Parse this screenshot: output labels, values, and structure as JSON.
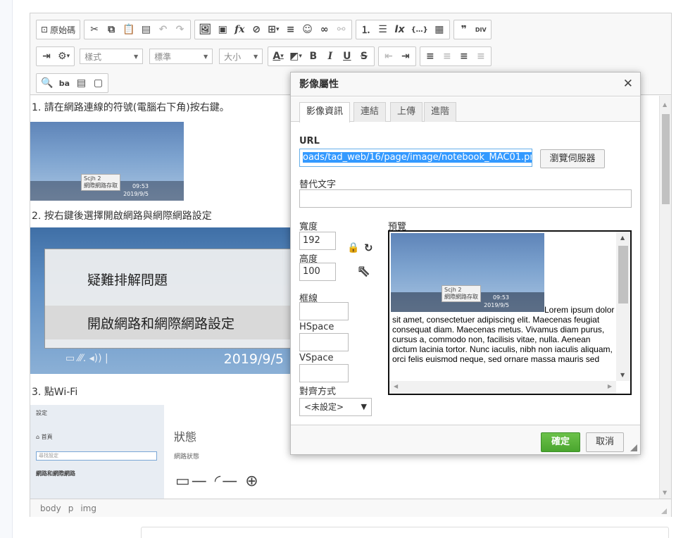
{
  "toolbar": {
    "source_label": "原始碼",
    "styles_combo": "樣式",
    "format_combo": "標準",
    "size_combo": "大小"
  },
  "content": {
    "step1": "1. 請在網路連線的符號(電腦右下角)按右鍵。",
    "step2": "2. 按右鍵後選擇開啟網路與網際網路設定",
    "step3": "3. 點Wi-Fi",
    "taskbar_tooltip_title": "Scjh 2",
    "taskbar_tooltip_sub": "網際網路存取",
    "taskbar_time": "09:53",
    "taskbar_date": "2019/9/5",
    "menu_item_troubleshoot": "疑難排解問題",
    "menu_item_open_settings": "開啟網路和網際網路設定",
    "big_date": "2019/9/5",
    "settings_header": "設定",
    "settings_home": "首頁",
    "settings_search_placeholder": "尋找設定",
    "settings_section": "網路和網際網路",
    "status_title": "狀態",
    "status_sub": "網路狀態"
  },
  "statusbar": {
    "path_body": "body",
    "path_p": "p",
    "path_img": "img"
  },
  "dialog": {
    "title": "影像屬性",
    "tabs": [
      "影像資訊",
      "連結",
      "上傳",
      "進階"
    ],
    "url_label": "URL",
    "url_value": "oads/tad_web/16/page/image/notebook_MAC01.png",
    "browse_label": "瀏覽伺服器",
    "alt_label": "替代文字",
    "alt_value": "",
    "width_label": "寬度",
    "width_value": "192",
    "height_label": "高度",
    "height_value": "100",
    "border_label": "框線",
    "hspace_label": "HSpace",
    "vspace_label": "VSpace",
    "align_label": "對齊方式",
    "align_value": "<未設定>",
    "preview_label": "預覽",
    "preview_text": "Lorem ipsum dolor sit amet, consectetuer adipiscing elit. Maecenas feugiat consequat diam. Maecenas metus. Vivamus diam purus, cursus a, commodo non, facilisis vitae, nulla. Aenean dictum lacinia tortor. Nunc iaculis, nibh non iaculis aliquam, orci felis euismod neque, sed ornare massa mauris sed",
    "ok_label": "確定",
    "cancel_label": "取消"
  },
  "colors": {
    "ok_green": "#4aa52e",
    "selection_blue": "#3399ff"
  }
}
